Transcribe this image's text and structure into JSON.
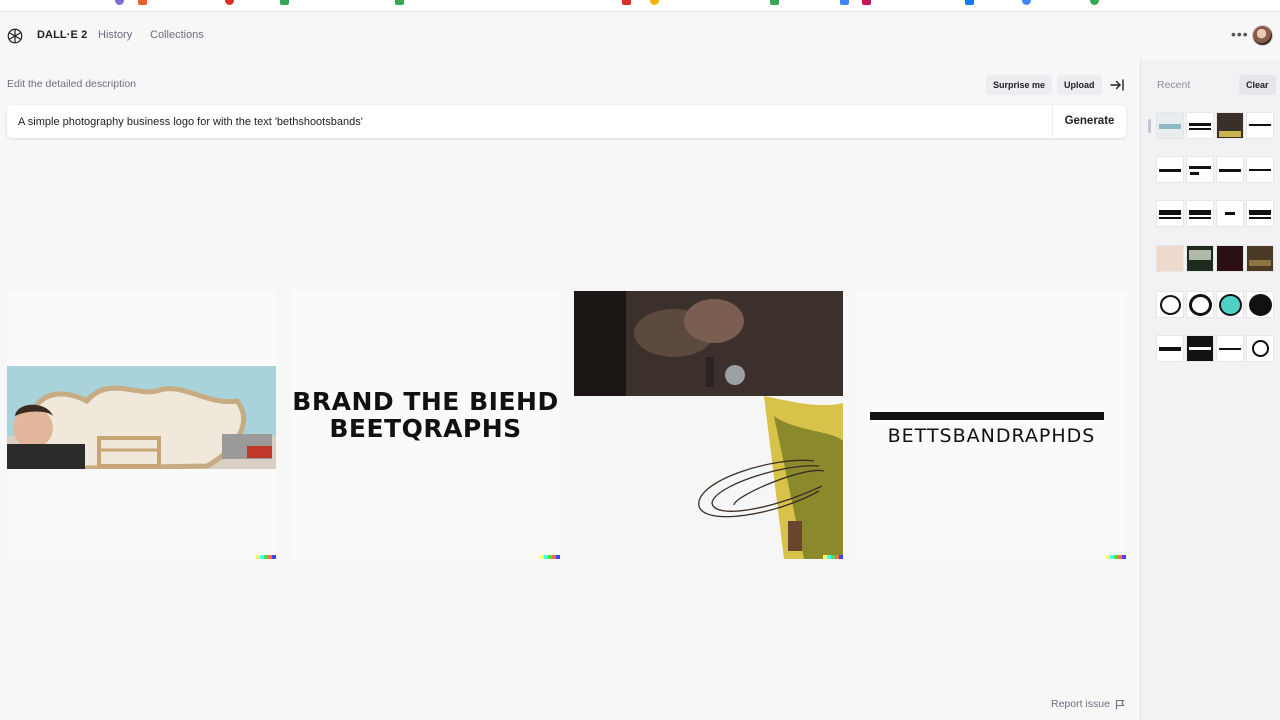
{
  "header": {
    "brand": "DALL·E 2",
    "nav": [
      {
        "label": "History"
      },
      {
        "label": "Collections"
      }
    ],
    "more_icon": "more-horizontal-icon",
    "avatar": "user-avatar"
  },
  "prompt": {
    "label": "Edit the detailed description",
    "surprise_label": "Surprise me",
    "upload_label": "Upload",
    "value": "A simple photography business logo for with the text 'bethshootsbands'",
    "generate_label": "Generate"
  },
  "results": [
    {
      "kind": "photo",
      "description_icon": "guitar-photo"
    },
    {
      "kind": "logo",
      "line1": "BRAND THE BIEHD",
      "line2": "BEETQRAPHS"
    },
    {
      "kind": "photo",
      "description_icon": "band-photo"
    },
    {
      "kind": "logo",
      "line1": "BETTSBANDRAPHDS"
    }
  ],
  "sidebar": {
    "recent_label": "Recent",
    "clear_label": "Clear"
  },
  "footer": {
    "report_label": "Report issue"
  },
  "colors": {
    "background": "#f7f7f8",
    "sidebar": "#f2f2f4",
    "text": "#202123",
    "muted": "#6e6e80"
  }
}
